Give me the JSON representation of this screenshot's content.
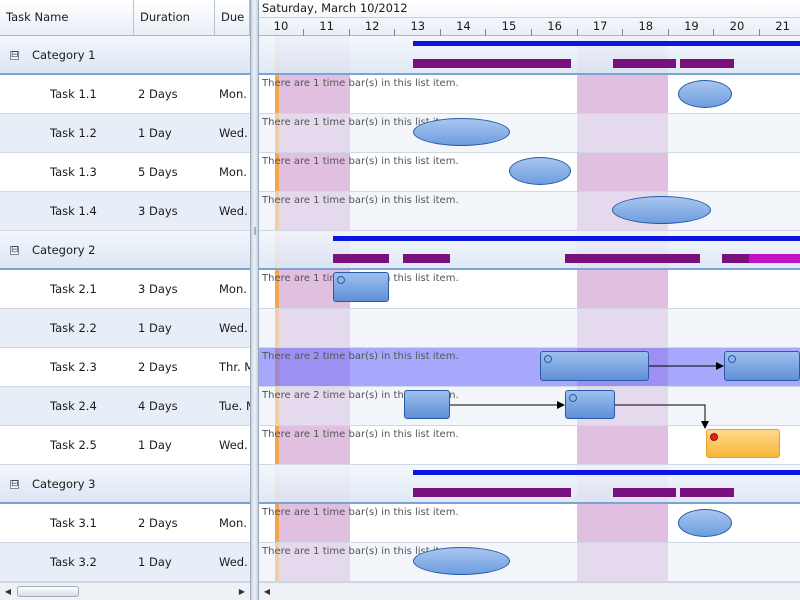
{
  "grid": {
    "columns": [
      {
        "key": "name",
        "label": "Task Name"
      },
      {
        "key": "duration",
        "label": "Duration"
      },
      {
        "key": "due",
        "label": "Due B"
      }
    ],
    "rows": [
      {
        "type": "category",
        "label": "Category 1"
      },
      {
        "type": "task",
        "name": "Task 1.1",
        "duration": "2 Days",
        "due": "Mon."
      },
      {
        "type": "task",
        "name": "Task 1.2",
        "duration": "1 Day",
        "due": "Wed."
      },
      {
        "type": "task",
        "name": "Task 1.3",
        "duration": "5 Days",
        "due": "Mon."
      },
      {
        "type": "task",
        "name": "Task 1.4",
        "duration": "3 Days",
        "due": "Wed."
      },
      {
        "type": "category",
        "label": "Category 2"
      },
      {
        "type": "task",
        "name": "Task 2.1",
        "duration": "3 Days",
        "due": "Mon."
      },
      {
        "type": "task",
        "name": "Task 2.2",
        "duration": "1 Day",
        "due": "Wed."
      },
      {
        "type": "task",
        "name": "Task 2.3",
        "duration": "2 Days",
        "due": "Thr. M"
      },
      {
        "type": "task",
        "name": "Task 2.4",
        "duration": "4 Days",
        "due": "Tue. M"
      },
      {
        "type": "task",
        "name": "Task 2.5",
        "duration": "1 Day",
        "due": "Wed."
      },
      {
        "type": "category",
        "label": "Category  3"
      },
      {
        "type": "task",
        "name": "Task  3.1",
        "duration": "2 Days",
        "due": "Mon."
      },
      {
        "type": "task",
        "name": "Task  3.2",
        "duration": "1 Day",
        "due": "Wed."
      }
    ],
    "expander_symbol": "⊟"
  },
  "timeline": {
    "date_label": "Saturday, March 10/2012",
    "days": [
      "10",
      "11",
      "12",
      "13",
      "14",
      "15",
      "16",
      "17",
      "18",
      "19",
      "20",
      "21"
    ]
  },
  "chart_rows": [
    {
      "type": "category"
    },
    {
      "text": "There are 1 time bar(s) in this list item."
    },
    {
      "text": "There are 1 time bar(s) in this list item."
    },
    {
      "text": "There are 1 time bar(s) in this list item."
    },
    {
      "text": "There are 1 time bar(s) in this list item."
    },
    {
      "type": "category"
    },
    {
      "text": "There are 1 time bar(s) in this list item."
    },
    {
      "text": ""
    },
    {
      "text": "There are 2 time bar(s) in this list item.",
      "selected": true
    },
    {
      "text": "There are 2 time bar(s) in this list item."
    },
    {
      "text": "There are 1 time bar(s) in this list item."
    },
    {
      "type": "category"
    },
    {
      "text": "There are 1 time bar(s) in this list item."
    },
    {
      "text": "There are 1 time bar(s) in this list item."
    }
  ],
  "colors": {
    "summary": "#0b16e0",
    "subtask": "#7a107e",
    "highlight": "#c010c8",
    "weekend": "#e0bfe1",
    "today": "#f4a64a",
    "selected_row": "#7878fa",
    "bar_blue": "#6d9de0",
    "bar_yellow": "#f7b63a"
  },
  "scroll": {
    "left_arrow": "◀",
    "right_arrow": "▶"
  }
}
